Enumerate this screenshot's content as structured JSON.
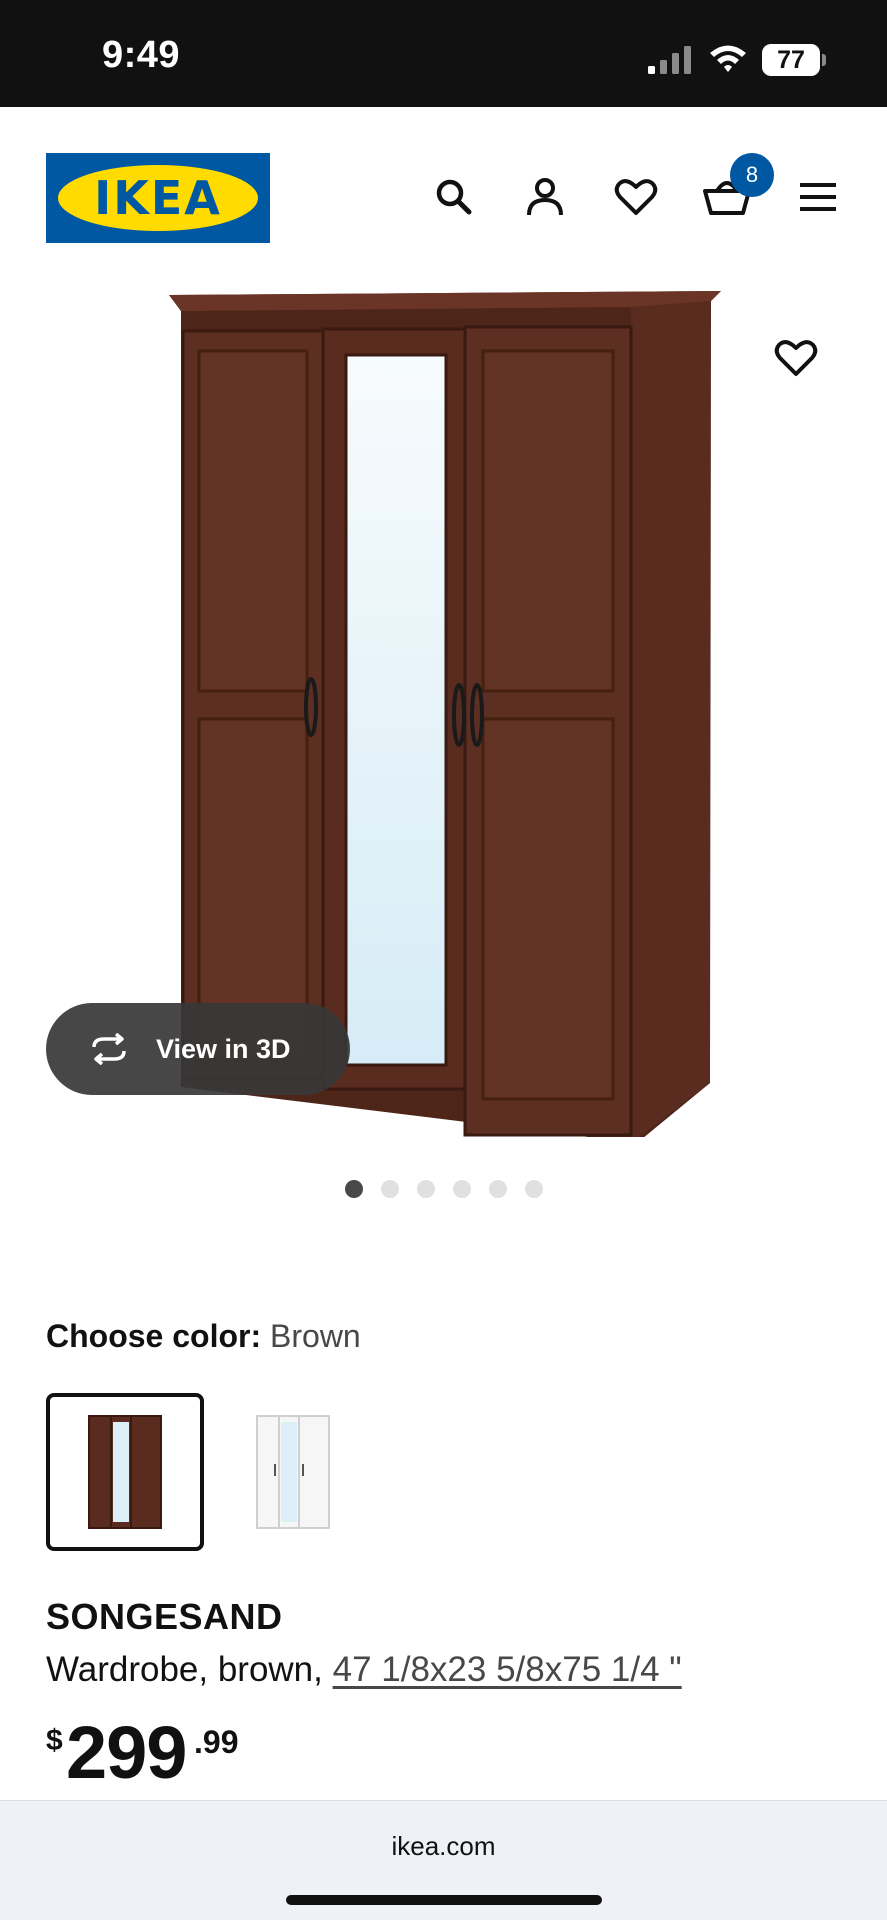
{
  "status_bar": {
    "time": "9:49",
    "battery": "77"
  },
  "header": {
    "logo_text": "IKEA",
    "cart_count": "8",
    "icons": [
      "search-icon",
      "user-icon",
      "heart-icon",
      "cart-icon",
      "menu-icon"
    ]
  },
  "gallery": {
    "view_3d_label": "View in 3D",
    "image_count": 6,
    "active_image_index": 0
  },
  "color_chooser": {
    "label": "Choose color:",
    "selected": "Brown",
    "options": [
      "Brown",
      "White"
    ]
  },
  "product": {
    "name": "SONGESAND",
    "type": "Wardrobe, brown, ",
    "dimensions": "47 1/8x23 5/8x75 1/4 \"",
    "price_currency": "$",
    "price_integer": "299",
    "price_decimal": ".99"
  },
  "browser": {
    "url": "ikea.com"
  },
  "colors": {
    "ikea_blue": "#0058a3",
    "ikea_yellow": "#ffdb00",
    "wood": "#5a2e22"
  }
}
